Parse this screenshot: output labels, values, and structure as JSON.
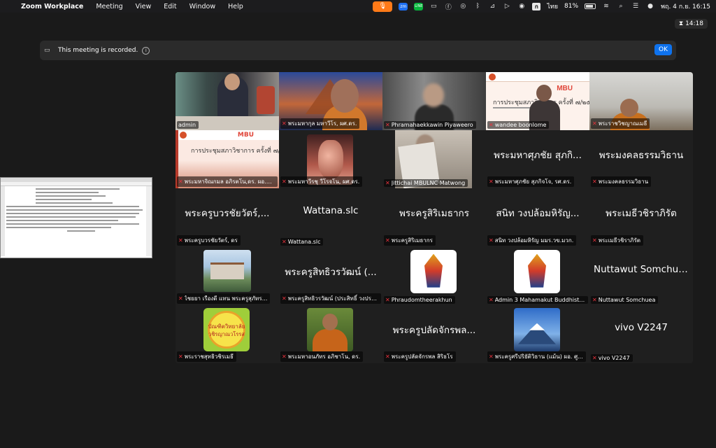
{
  "menubar": {
    "apple": "",
    "app_name": "Zoom Workplace",
    "items": [
      "Meeting",
      "View",
      "Edit",
      "Window",
      "Help"
    ],
    "status": {
      "input_source": "ก",
      "language": "ไทย",
      "battery": "81%",
      "datetime": "พฤ. 4 ก.ย.  16:15"
    }
  },
  "meeting": {
    "timer": "14:18",
    "recording_banner": "This meeting is recorded.",
    "ok_label": "OK"
  },
  "participants": [
    {
      "name": "admin",
      "display": "",
      "video": "admin",
      "muted": false,
      "active": true
    },
    {
      "name": "พระมหากุล มหาวีโร, ผศ.ดร.",
      "display": "",
      "video": "temple",
      "muted": true
    },
    {
      "name": "Phramahaekkawin Piyaweero",
      "display": "",
      "video": "blur",
      "muted": true
    },
    {
      "name": "wandee boonlome",
      "display": "",
      "video": "slide",
      "muted": true
    },
    {
      "name": "พระราชวิชญาณเมธี",
      "display": "",
      "video": "office",
      "muted": true
    },
    {
      "name": "พระมหาจิณกมล อภิรตโน,ดร. ผอ.ส...",
      "display": "",
      "video": "slide2",
      "muted": true
    },
    {
      "name": "พระมหาวีรชุ วีโรจโน, ผศ.ดร.",
      "display": "",
      "video": "buddha",
      "muted": true
    },
    {
      "name": "Jittichai MBULNC Matwong",
      "display": "",
      "video": "doc",
      "muted": true
    },
    {
      "name": "พระมหาศุภชัย สุภกิจโจ, รศ.ดร.",
      "display": "พระมหาศุภชัย สุภกิ...",
      "video": "none",
      "muted": true
    },
    {
      "name": "พระมงคลธรรมวิธาน",
      "display": "พระมงคลธรรมวิธาน",
      "video": "none",
      "muted": true
    },
    {
      "name": "พระครูบวรชัยวัตร์, ดร",
      "display": "พระครูบวรชัยวัตร์,...",
      "video": "none",
      "muted": true
    },
    {
      "name": "Wattana.slc",
      "display": "Wattana.slc",
      "video": "none",
      "muted": true
    },
    {
      "name": "พระครูสิริเมธากร",
      "display": "พระครูสิริเมธากร",
      "video": "none",
      "muted": true
    },
    {
      "name": "สนิท  วงปล้อมหิรัญ มมร.วข.มวก.",
      "display": "สนิท  วงปล้อมหิรัญ...",
      "video": "none",
      "muted": true
    },
    {
      "name": "พระเมธีวชิราภิรัต",
      "display": "พระเมธีวชิราภิรัต",
      "video": "none",
      "muted": true
    },
    {
      "name": "ไชยยา  เรืองดี  แทน  พระครูสุภัทร...",
      "display": "",
      "video": "building",
      "muted": true
    },
    {
      "name": "พระครูสิทธิวรวัฒน์ (ประสิทธิ์ วงประ...",
      "display": "พระครูสิทธิวรวัฒน์ (...",
      "video": "none",
      "muted": true
    },
    {
      "name": "Phraudomtheerakhun",
      "display": "",
      "video": "crest",
      "muted": true
    },
    {
      "name": "Admin 3 Mahamakut Buddhist Un...",
      "display": "",
      "video": "crest",
      "muted": true
    },
    {
      "name": "Nuttawut Somchuea",
      "display": "Nuttawut Somchuea",
      "video": "none",
      "muted": true
    },
    {
      "name": "พระราชสุทธิวชิรเมธี",
      "display": "",
      "video": "green",
      "muted": true
    },
    {
      "name": "พระมหาอนภัทร อภิชาโน, ดร.",
      "display": "",
      "video": "monkphoto",
      "muted": true
    },
    {
      "name": "พระครูปลัดจักรพล สิริธโร",
      "display": "พระครูปลัดจักรพล...",
      "video": "none",
      "muted": true
    },
    {
      "name": "พระครูศรีปริยัติวิธาน (แม้น) ผอ. ศู...",
      "display": "",
      "video": "fuji",
      "muted": true
    },
    {
      "name": "vivo V2247",
      "display": "vivo V2247",
      "video": "none",
      "muted": true
    }
  ],
  "logo_text": {
    "green_line1": "บัณฑิตวิทยาลัย",
    "green_line2": "วชิรญาณวโรรส"
  },
  "slide_text": {
    "mbu": "MBU",
    "title": "การประชุมสภาวิชาการ ครั้งที่ ๗/๒๕๖๘"
  },
  "colors": {
    "active_speaker": "#23d160",
    "mute_icon": "#e8323c",
    "ok_button": "#0e72ed",
    "mic_indicator": "#ff7a18"
  }
}
